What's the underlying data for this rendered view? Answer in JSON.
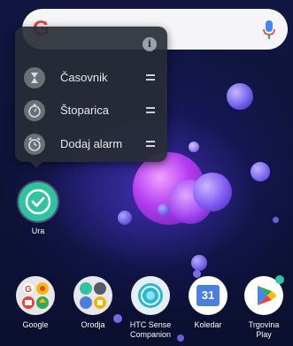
{
  "search": {
    "logo": "G"
  },
  "popup": {
    "shortcuts": [
      {
        "label": "Časovnik",
        "icon": "hourglass-icon"
      },
      {
        "label": "Štoparica",
        "icon": "stopwatch-icon"
      },
      {
        "label": "Dodaj alarm",
        "icon": "alarm-icon"
      }
    ]
  },
  "widget_app": {
    "label": "Ura"
  },
  "dock": [
    {
      "label": "Google",
      "icon": "google-folder-icon"
    },
    {
      "label": "Orodja",
      "icon": "tools-folder-icon"
    },
    {
      "label": "HTC Sense Companion",
      "line1": "HTC Sense",
      "line2": "Companion",
      "icon": "htc-sense-companion-icon"
    },
    {
      "label": "Koledar",
      "icon": "calendar-icon",
      "date": "31"
    },
    {
      "label": "Trgovina Play",
      "line1": "Trgovina",
      "line2": "Play",
      "icon": "play-store-icon"
    }
  ],
  "colors": {
    "clock_app": "#2ec4a0",
    "calendar": "#4a7fe0",
    "mic": "#4285f4",
    "google_red": "#ea4335"
  }
}
